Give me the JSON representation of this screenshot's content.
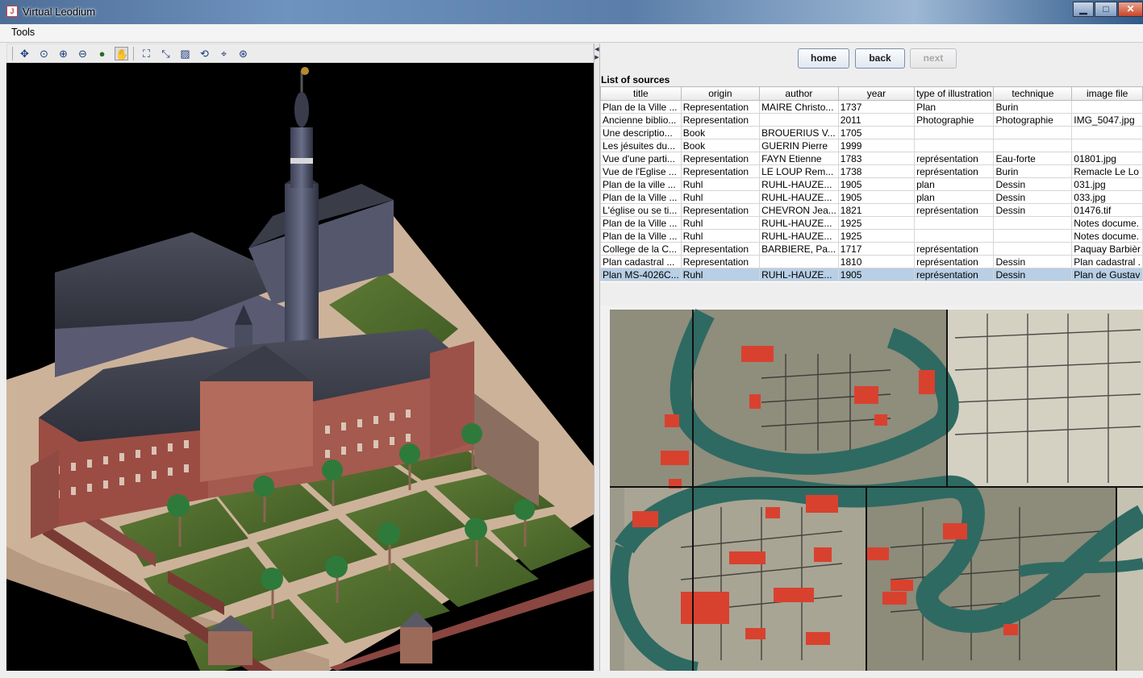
{
  "window": {
    "title": "Virtual Leodium",
    "controls": {
      "minimize": "▁",
      "maximize": "□",
      "close": "✕"
    }
  },
  "menu": {
    "tools": "Tools"
  },
  "toolbar": {
    "icons": [
      "pan-icon",
      "zoom-region-icon",
      "zoom-in-icon",
      "zoom-out-icon",
      "globe-icon",
      "hand-icon",
      "fit-all-icon",
      "shrink-icon",
      "select-region-icon",
      "rotate-icon",
      "move-icon",
      "center-icon"
    ]
  },
  "nav": {
    "home": "home",
    "back": "back",
    "next": "next"
  },
  "sources": {
    "title": "List of sources",
    "columns": [
      "title",
      "origin",
      "author",
      "year",
      "type of illustration",
      "technique",
      "image file"
    ],
    "rows": [
      [
        "Plan de la Ville ...",
        "Representation",
        "MAIRE Christo...",
        "1737",
        "Plan",
        "Burin",
        ""
      ],
      [
        "Ancienne biblio...",
        "Representation",
        "",
        "2011",
        "Photographie",
        "Photographie",
        "IMG_5047.jpg"
      ],
      [
        "Une descriptio...",
        "Book",
        "BROUERIUS V...",
        "1705",
        "",
        "",
        ""
      ],
      [
        "Les jésuites du...",
        "Book",
        "GUERIN Pierre",
        "1999",
        "",
        "",
        ""
      ],
      [
        "Vue d'une parti...",
        "Representation",
        "FAYN Etienne",
        "1783",
        "représentation",
        "Eau-forte",
        "01801.jpg"
      ],
      [
        "Vue de l'Eglise ...",
        "Representation",
        "LE LOUP Rem...",
        "1738",
        "représentation",
        "Burin",
        "Remacle Le Lo"
      ],
      [
        "Plan de la ville ...",
        "Ruhl",
        "RUHL-HAUZE...",
        "1905",
        "plan",
        "Dessin",
        "031.jpg"
      ],
      [
        "Plan de la Ville ...",
        "Ruhl",
        "RUHL-HAUZE...",
        "1905",
        "plan",
        "Dessin",
        "033.jpg"
      ],
      [
        "L'église ou se ti...",
        "Representation",
        "CHEVRON Jea...",
        "1821",
        "représentation",
        "Dessin",
        "01476.tif"
      ],
      [
        "Plan de la Ville ...",
        "Ruhl",
        "RUHL-HAUZE...",
        "1925",
        "",
        "",
        "Notes docume."
      ],
      [
        "Plan de la Ville ...",
        "Ruhl",
        "RUHL-HAUZE...",
        "1925",
        "",
        "",
        "Notes docume."
      ],
      [
        "College de la C...",
        "Representation",
        "BARBIERE, Pa...",
        "1717",
        "représentation",
        "",
        "Paquay Barbièr"
      ],
      [
        "Plan cadastral ...",
        "Representation",
        "",
        "1810",
        "représentation",
        "Dessin",
        "Plan cadastral ."
      ],
      [
        "Plan MS-4026C...",
        "Ruhl",
        "RUHL-HAUZE...",
        "1905",
        "représentation",
        "Dessin",
        "Plan de Gustav"
      ]
    ],
    "selected_row": 13
  },
  "colors": {
    "selection": "#b8cfe5",
    "roof": "#3c3e4a",
    "brick": "#8a4640",
    "lawn": "#4f6a2c",
    "river": "#2e6a62",
    "map_building": "#d9412f"
  }
}
